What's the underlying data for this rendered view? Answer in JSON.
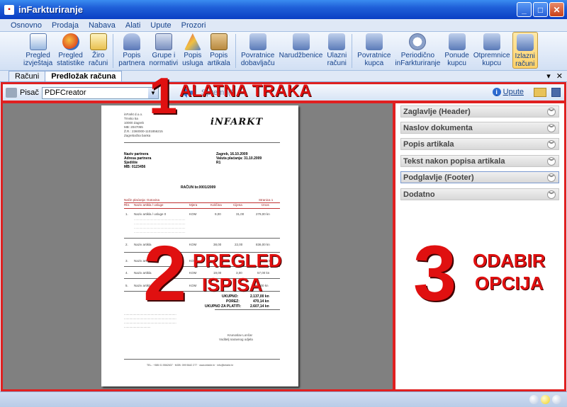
{
  "window": {
    "title": "inFarkturiranje"
  },
  "menu": [
    "Osnovno",
    "Prodaja",
    "Nabava",
    "Alati",
    "Upute",
    "Prozori"
  ],
  "ribbon": [
    {
      "label1": "Pregled",
      "label2": "izvještaja",
      "icon": "report-icon"
    },
    {
      "label1": "Pregled",
      "label2": "statistike",
      "icon": "stats-icon"
    },
    {
      "label1": "Žiro",
      "label2": "računi",
      "icon": "bank-account-icon"
    },
    {
      "label1": "Popis",
      "label2": "partnera",
      "icon": "partners-icon"
    },
    {
      "label1": "Grupe i",
      "label2": "normativi",
      "icon": "groups-icon"
    },
    {
      "label1": "Popis",
      "label2": "usluga",
      "icon": "services-icon"
    },
    {
      "label1": "Popis",
      "label2": "artikala",
      "icon": "articles-icon"
    },
    {
      "label1": "Povratnice",
      "label2": "dobavljaču",
      "icon": "return-supplier-icon"
    },
    {
      "label1": "Narudžbenice",
      "label2": "",
      "icon": "orders-icon"
    },
    {
      "label1": "Ulazni",
      "label2": "računi",
      "icon": "incoming-invoices-icon"
    },
    {
      "label1": "Povratnice",
      "label2": "kupca",
      "icon": "return-customer-icon"
    },
    {
      "label1": "Periodično",
      "label2": "inFarkturiranje",
      "icon": "periodic-icon"
    },
    {
      "label1": "Ponude",
      "label2": "kupcu",
      "icon": "offers-icon"
    },
    {
      "label1": "Otpremnice",
      "label2": "kupcu",
      "icon": "delivery-notes-icon"
    },
    {
      "label1": "Izlazni",
      "label2": "računi",
      "icon": "outgoing-invoices-icon"
    }
  ],
  "tabs": [
    "Računi",
    "Predložak računa"
  ],
  "toolbar": {
    "printer_label": "Pisač",
    "printer_value": "PDFCreator",
    "faded": "Spremi (F",
    "help": "Upute"
  },
  "options": [
    "Zaglavlje (Header)",
    "Naslov dokumenta",
    "Popis artikala",
    "Tekst nakon popisa artikala",
    "Podglavlje (Footer)",
    "Dodatno"
  ],
  "annotations": {
    "n1": "1",
    "t1": "ALATNA TRAKA",
    "n2": "2",
    "t2a": "PREGLED",
    "t2b": "ISPISA",
    "n3": "3",
    "t3a": "ODABIR",
    "t3b": "OPCIJA"
  },
  "paper": {
    "company": [
      "inFarkt d.o.o.",
      "Trnsko 5a",
      "10000 Zagreb",
      "MB: 2047055",
      "Ž.R.: 2360000-1101856215",
      "Zagrebačka banka"
    ],
    "partner": [
      "Naziv partnera",
      "Adresa partnera",
      "Sjedište",
      "MB: 0123456"
    ],
    "dates": [
      "Zagreb, 16.10.2009",
      "Valuta plaćanja: 31.10.2009",
      "R1"
    ],
    "title": "RAČUN br.0001/2009",
    "payment": "Način plaćanja: Gotovina",
    "page": "Stranica 1",
    "headers": [
      "Rbr.",
      "Naziv artikla / usluge",
      "Mjera",
      "Količina",
      "Cijena",
      "Iznos"
    ],
    "rows": [
      [
        "1.",
        "Naziv artikla / usluge 0",
        "KOM",
        "9,00",
        "31,00",
        "279,00 kn"
      ],
      [
        "2.",
        "Naziv artikla",
        "KOM",
        "38,00",
        "22,00",
        "836,00 kn"
      ],
      [
        "3.",
        "Naziv artikla",
        "KOM",
        "",
        "",
        "kn"
      ],
      [
        "4.",
        "Naziv artikla",
        "KOM",
        "19,00",
        "3,00",
        "57,00 kn"
      ],
      [
        "5.",
        "Naziv artikla",
        "KOM",
        "",
        "",
        "1.667,00 kn"
      ]
    ],
    "totals": [
      [
        "UKUPNO:",
        "2.137,00 kn"
      ],
      [
        "POREZ:",
        "470,14 kn"
      ],
      [
        "UKUPNO ZA PLATITI:",
        "2.607,14 kn"
      ]
    ],
    "signature": [
      "Krunoslav Lončar",
      "Voditelj naravnog odjela"
    ],
    "footer": "TEL.: +385 01 5562637 · MOB: 099 5642 277 · www.infarkt.hr · info@infarkt.hr"
  }
}
